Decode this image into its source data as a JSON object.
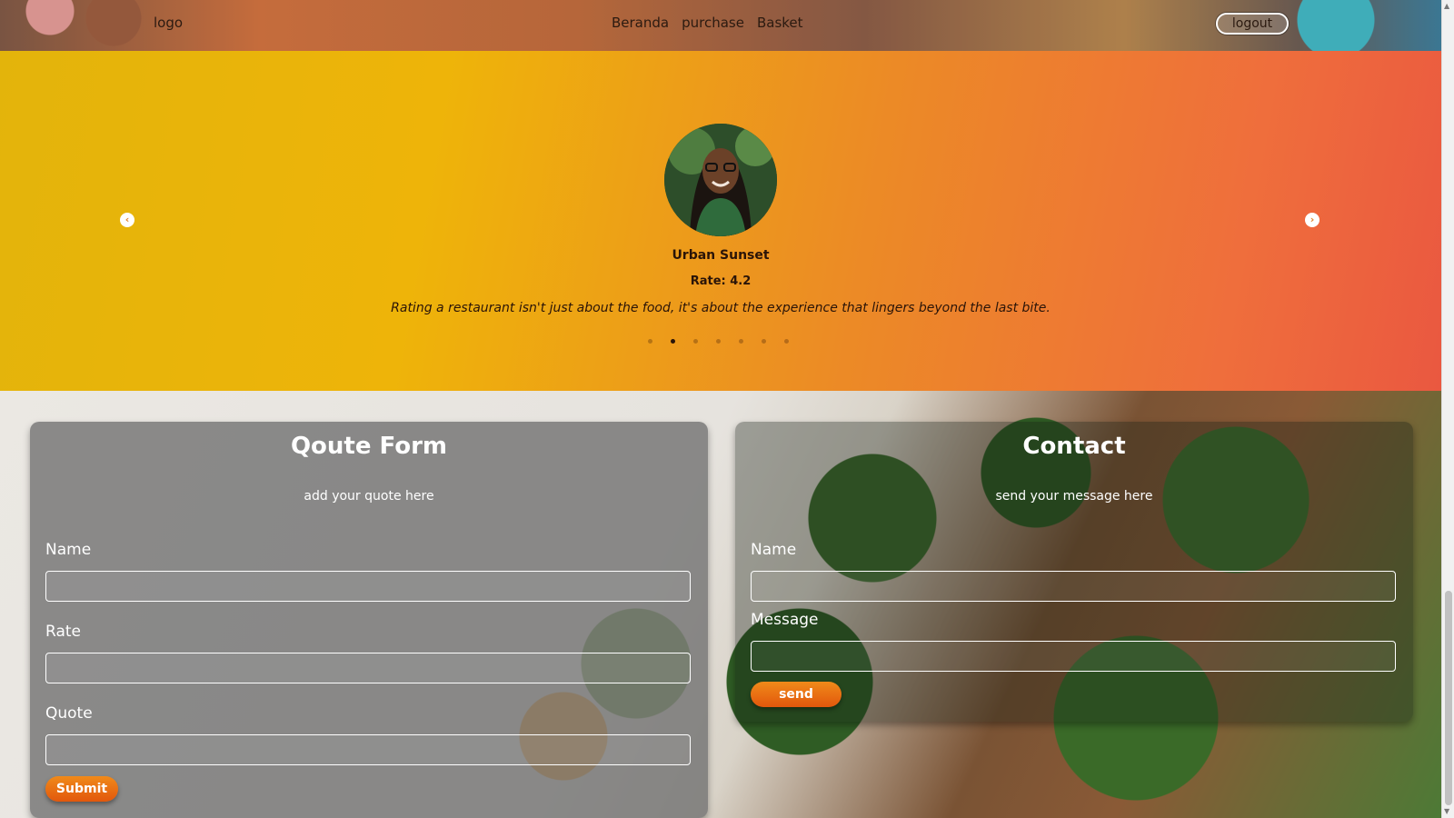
{
  "nav": {
    "logo": "logo",
    "links": [
      "Beranda",
      "purchase",
      "Basket"
    ],
    "logout_label": "logout"
  },
  "testimonial": {
    "name": "Urban Sunset",
    "rate": "Rate: 4.2",
    "quote": "Rating a restaurant isn't just about the food, it's about the experience that lingers beyond the last bite.",
    "slide_count": 7,
    "active_slide": 2,
    "prev_icon": "chevron-left-circle-icon",
    "next_icon": "chevron-right-circle-icon"
  },
  "quote_form": {
    "title": "Qoute Form",
    "subtitle": "add your quote here",
    "fields": [
      {
        "label": "Name",
        "value": ""
      },
      {
        "label": "Rate",
        "value": ""
      },
      {
        "label": "Quote",
        "value": ""
      }
    ],
    "submit_label": "Submit"
  },
  "contact": {
    "title": "Contact",
    "subtitle": "send your message here",
    "fields": [
      {
        "label": "Name",
        "value": ""
      },
      {
        "label": "Message",
        "value": ""
      }
    ],
    "send_label": "send"
  },
  "colors": {
    "accent_orange": "#e9640f",
    "gradient_start": "#e3b40b",
    "gradient_end": "#ea5840"
  }
}
